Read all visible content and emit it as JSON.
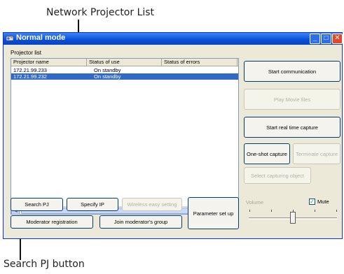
{
  "callouts": {
    "top": "Network Projector List",
    "bottom": "Search PJ button"
  },
  "window": {
    "title": "Normal mode",
    "icon": "projector-app-icon"
  },
  "projector_list": {
    "group_label": "Projector list",
    "columns": [
      "Projector name",
      "Status of use",
      "Status of errors"
    ],
    "rows": [
      {
        "name": "172.21.99.233",
        "status": "On standby",
        "errors": "",
        "selected": false
      },
      {
        "name": "172.21.99.232",
        "status": "On standby",
        "errors": "",
        "selected": true
      }
    ]
  },
  "buttons": {
    "start_communication": "Start communication",
    "play_movie": "Play Movie files",
    "start_capture": "Start real time capture",
    "one_shot": "One-shot capture",
    "terminate_capture": "Terminate capture",
    "select_capturing": "Select capturing object",
    "search_pj": "Search PJ",
    "specify_ip": "Specify IP",
    "wireless_setting": "Wireless easy setting",
    "moderator_registration": "Moderator registration",
    "join_group": "Join moderator's group",
    "parameter_setup": "Parameter set up"
  },
  "volume": {
    "label": "Volume",
    "mute_label": "Mute",
    "mute_checked": true,
    "level_fraction": 0.5
  },
  "colors": {
    "titlebar": "#0a4fd6",
    "selection": "#316ac5",
    "window_bg": "#ece9d8"
  }
}
